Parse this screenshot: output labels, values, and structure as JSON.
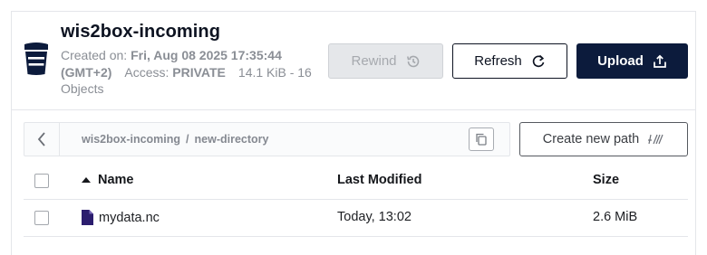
{
  "header": {
    "title": "wis2box-incoming",
    "created_label": "Created on:",
    "created_value": "Fri, Aug 08 2025 17:35:44 (GMT+2)",
    "access_label": "Access:",
    "access_value": "PRIVATE",
    "size_summary": "14.1 KiB - 16 Objects"
  },
  "actions": {
    "rewind_label": "Rewind",
    "refresh_label": "Refresh",
    "upload_label": "Upload"
  },
  "path": {
    "segments": [
      "wis2box-incoming",
      "new-directory"
    ],
    "separator": "/",
    "create_new_path_label": "Create new path"
  },
  "table": {
    "columns": {
      "name": "Name",
      "last_modified": "Last Modified",
      "size": "Size"
    },
    "rows": [
      {
        "name": "mydata.nc",
        "last_modified": "Today, 13:02",
        "size": "2.6 MiB"
      }
    ]
  },
  "colors": {
    "primary": "#0c1b3c",
    "file_icon": "#2b1d6e",
    "muted_text": "#8a8e95"
  },
  "icons": {
    "bucket": "bucket-icon",
    "rewind": "history-icon",
    "refresh": "refresh-icon",
    "upload": "upload-icon",
    "back": "chevron-left-icon",
    "copy": "copy-icon",
    "new_path": "new-path-icon",
    "sort": "sort-ascending-icon",
    "file": "file-icon"
  }
}
